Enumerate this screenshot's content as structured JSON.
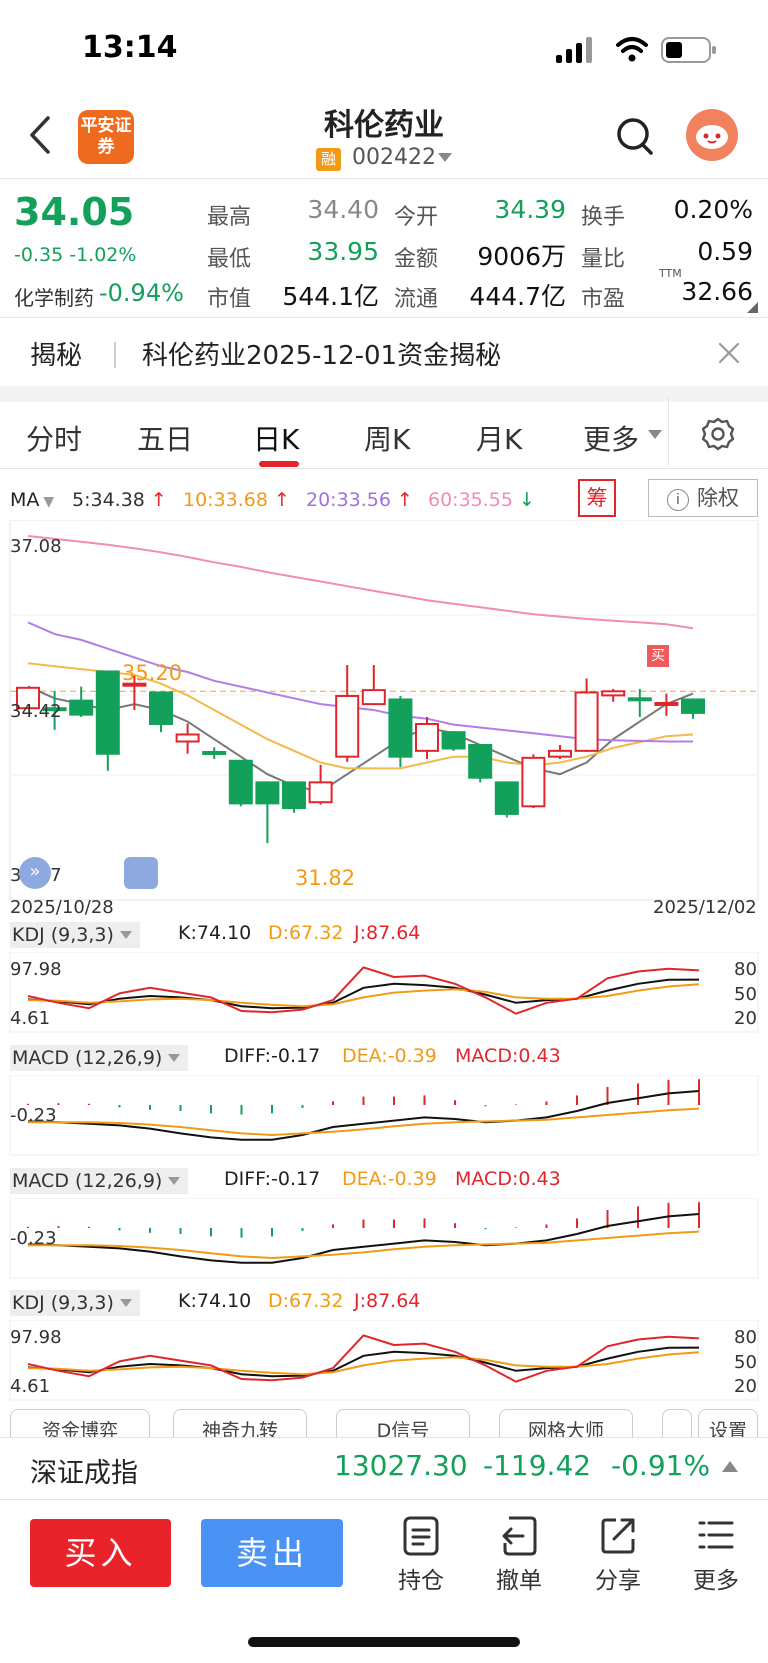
{
  "status_bar": {
    "time": "13:14"
  },
  "header": {
    "broker_logo": "平安证券",
    "stock_name": "科伦药业",
    "margin_badge": "融",
    "stock_code": "002422"
  },
  "quote": {
    "last_price": "34.05",
    "change": "-0.35",
    "change_pct": "-1.02%",
    "industry_name": "化学制药",
    "industry_change": "-0.94%",
    "fields": [
      {
        "label": "最高",
        "value": "34.40",
        "color": "#888888"
      },
      {
        "label": "今开",
        "value": "34.39",
        "color": "#13a05a"
      },
      {
        "label": "换手",
        "value": "0.20%",
        "color": "#111111"
      },
      {
        "label": "最低",
        "value": "33.95",
        "color": "#13a05a"
      },
      {
        "label": "金额",
        "value": "9006万",
        "color": "#111111"
      },
      {
        "label": "量比",
        "value": "0.59",
        "color": "#111111"
      },
      {
        "label": "市值",
        "value": "544.1亿",
        "color": "#111111"
      },
      {
        "label": "流通",
        "value": "444.7亿",
        "color": "#111111"
      },
      {
        "label": "市盈",
        "value": "32.66",
        "color": "#111111"
      }
    ],
    "pe_suffix": "TTM"
  },
  "reveal": {
    "label": "揭秘",
    "text": "科伦药业2025-12-01资金揭秘"
  },
  "tabs": [
    "分时",
    "五日",
    "日K",
    "周K",
    "月K",
    "更多"
  ],
  "ma_legend": {
    "label": "MA",
    "ma5": "5:34.38",
    "ma10": "10:33.68",
    "ma20": "20:33.56",
    "ma60": "60:35.55",
    "chip_label": "筹",
    "exright_label": "除权"
  },
  "kline": {
    "y_top": "37.08",
    "y_mid": "34.42",
    "y_bottom": "31.77",
    "date_start": "2025/10/28",
    "date_end": "2025/12/02",
    "high_label": "35.20",
    "low_label": "31.82",
    "buy_marker": "买"
  },
  "chart_data": {
    "type": "candlestick",
    "x": [
      "10/28",
      "10/29",
      "10/30",
      "10/31",
      "11/03",
      "11/04",
      "11/05",
      "11/06",
      "11/07",
      "11/10",
      "11/11",
      "11/12",
      "11/13",
      "11/14",
      "11/17",
      "11/18",
      "11/19",
      "11/20",
      "11/21",
      "11/24",
      "11/25",
      "11/26",
      "11/27",
      "11/28",
      "12/01",
      "12/02"
    ],
    "ylim": [
      31.77,
      37.08
    ],
    "candles": [
      {
        "o": 34.13,
        "c": 34.48,
        "h": 34.48,
        "l": 34.13
      },
      {
        "o": 34.13,
        "c": 34.13,
        "h": 34.42,
        "l": 33.76
      },
      {
        "o": 34.26,
        "c": 34.02,
        "h": 34.5,
        "l": 33.98
      },
      {
        "o": 34.76,
        "c": 33.35,
        "h": 34.76,
        "l": 33.06
      },
      {
        "o": 34.55,
        "c": 34.55,
        "h": 34.69,
        "l": 34.1
      },
      {
        "o": 34.4,
        "c": 33.86,
        "h": 34.4,
        "l": 33.72
      },
      {
        "o": 33.56,
        "c": 33.68,
        "h": 33.87,
        "l": 33.35
      },
      {
        "o": 33.38,
        "c": 33.38,
        "h": 33.46,
        "l": 33.26
      },
      {
        "o": 33.23,
        "c": 32.5,
        "h": 33.23,
        "l": 32.45
      },
      {
        "o": 32.86,
        "c": 32.5,
        "h": 32.86,
        "l": 31.82
      },
      {
        "o": 32.86,
        "c": 32.42,
        "h": 32.86,
        "l": 32.34
      },
      {
        "o": 32.52,
        "c": 32.86,
        "h": 33.16,
        "l": 32.48
      },
      {
        "o": 33.3,
        "c": 34.34,
        "h": 34.87,
        "l": 33.21
      },
      {
        "o": 34.2,
        "c": 34.44,
        "h": 34.87,
        "l": 34.2
      },
      {
        "o": 34.28,
        "c": 33.3,
        "h": 34.34,
        "l": 33.12
      },
      {
        "o": 33.4,
        "c": 33.86,
        "h": 33.98,
        "l": 33.26
      },
      {
        "o": 33.72,
        "c": 33.44,
        "h": 33.74,
        "l": 33.4
      },
      {
        "o": 33.5,
        "c": 32.94,
        "h": 33.5,
        "l": 32.86
      },
      {
        "o": 32.86,
        "c": 32.32,
        "h": 32.86,
        "l": 32.26
      },
      {
        "o": 32.45,
        "c": 33.28,
        "h": 33.34,
        "l": 32.42
      },
      {
        "o": 33.3,
        "c": 33.4,
        "h": 33.5,
        "l": 33.26
      },
      {
        "o": 33.4,
        "c": 34.4,
        "h": 34.64,
        "l": 33.38
      },
      {
        "o": 34.35,
        "c": 34.42,
        "h": 34.46,
        "l": 34.24
      },
      {
        "o": 34.3,
        "c": 34.3,
        "h": 34.46,
        "l": 33.98
      },
      {
        "o": 34.22,
        "c": 34.22,
        "h": 34.38,
        "l": 34.0
      },
      {
        "o": 34.28,
        "c": 34.05,
        "h": 34.28,
        "l": 33.95
      }
    ],
    "series": [
      {
        "name": "MA5",
        "color": "#777777",
        "values": [
          34.5,
          34.3,
          34.2,
          34.1,
          34.2,
          34.1,
          33.9,
          33.6,
          33.3,
          33.0,
          32.8,
          32.7,
          33.0,
          33.3,
          33.6,
          33.8,
          33.7,
          33.5,
          33.3,
          33.1,
          33.0,
          33.2,
          33.6,
          33.9,
          34.2,
          34.38
        ]
      },
      {
        "name": "MA10",
        "color": "#f5b84a",
        "values": [
          34.9,
          34.85,
          34.8,
          34.75,
          34.7,
          34.55,
          34.35,
          34.1,
          33.85,
          33.6,
          33.4,
          33.2,
          33.1,
          33.1,
          33.1,
          33.2,
          33.3,
          33.3,
          33.2,
          33.15,
          33.2,
          33.3,
          33.45,
          33.55,
          33.65,
          33.68
        ]
      },
      {
        "name": "MA20",
        "color": "#b47ce8",
        "values": [
          35.6,
          35.4,
          35.3,
          35.15,
          35.0,
          34.85,
          34.75,
          34.6,
          34.5,
          34.4,
          34.3,
          34.2,
          34.15,
          34.1,
          34.0,
          33.95,
          33.85,
          33.8,
          33.75,
          33.7,
          33.65,
          33.6,
          33.58,
          33.57,
          33.56,
          33.56
        ]
      },
      {
        "name": "MA60",
        "color": "#f38bb8",
        "values": [
          37.08,
          37.03,
          36.98,
          36.93,
          36.87,
          36.8,
          36.72,
          36.63,
          36.55,
          36.46,
          36.38,
          36.3,
          36.22,
          36.14,
          36.06,
          35.98,
          35.92,
          35.86,
          35.8,
          35.74,
          35.7,
          35.66,
          35.63,
          35.6,
          35.57,
          35.5
        ]
      }
    ]
  },
  "indicators": {
    "kdj": {
      "label": "KDJ (9,3,3)",
      "k": "K:74.10",
      "d": "D:67.32",
      "j": "J:87.64",
      "y_top": "97.98",
      "y_bottom": "4.61",
      "levels": [
        "80",
        "50",
        "20"
      ],
      "k_values": [
        45,
        42,
        38,
        46,
        50,
        48,
        44,
        35,
        32,
        33,
        40,
        62,
        68,
        66,
        62,
        52,
        40,
        44,
        46,
        58,
        68,
        74,
        74.1
      ],
      "d_values": [
        44,
        43,
        40,
        42,
        45,
        46,
        44,
        40,
        37,
        35,
        38,
        48,
        55,
        58,
        60,
        56,
        48,
        46,
        46,
        50,
        58,
        64,
        67.32
      ],
      "j_values": [
        50,
        40,
        32,
        54,
        62,
        55,
        48,
        28,
        26,
        30,
        44,
        92,
        78,
        80,
        68,
        48,
        24,
        40,
        46,
        76,
        86,
        90,
        87.64
      ]
    },
    "macd": {
      "label": "MACD (12,26,9)",
      "diff": "DIFF:-0.17",
      "dea": "DEA:-0.39",
      "macd": "MACD:0.43",
      "y_label": "-0.23",
      "diff_values": [
        -0.55,
        -0.56,
        -0.58,
        -0.6,
        -0.64,
        -0.7,
        -0.75,
        -0.78,
        -0.78,
        -0.72,
        -0.62,
        -0.58,
        -0.54,
        -0.5,
        -0.52,
        -0.56,
        -0.54,
        -0.5,
        -0.42,
        -0.32,
        -0.26,
        -0.2,
        -0.17
      ],
      "dea_values": [
        -0.56,
        -0.56,
        -0.56,
        -0.57,
        -0.59,
        -0.62,
        -0.66,
        -0.7,
        -0.72,
        -0.7,
        -0.68,
        -0.65,
        -0.61,
        -0.58,
        -0.56,
        -0.55,
        -0.54,
        -0.53,
        -0.5,
        -0.47,
        -0.44,
        -0.41,
        -0.39
      ],
      "hist_values": [
        0.02,
        0.03,
        0.02,
        -0.04,
        -0.08,
        -0.1,
        -0.14,
        -0.16,
        -0.14,
        -0.05,
        0.06,
        0.14,
        0.14,
        0.16,
        0.08,
        -0.02,
        0.01,
        0.06,
        0.16,
        0.3,
        0.36,
        0.42,
        0.43
      ]
    }
  },
  "tool_chips": [
    "资金博弈",
    "神奇九转",
    "D信号",
    "网格大师",
    "",
    "设置"
  ],
  "index_bar": {
    "name": "深证成指",
    "value": "13027.30",
    "change": "-119.42",
    "pct": "-0.91%"
  },
  "trade_bar": {
    "buy_label": "买入",
    "sell_label": "卖出",
    "actions": [
      {
        "label": "持仓",
        "icon": "document-icon"
      },
      {
        "label": "撤单",
        "icon": "undo-icon"
      },
      {
        "label": "分享",
        "icon": "share-icon"
      },
      {
        "label": "更多",
        "icon": "menu-icon"
      }
    ]
  }
}
